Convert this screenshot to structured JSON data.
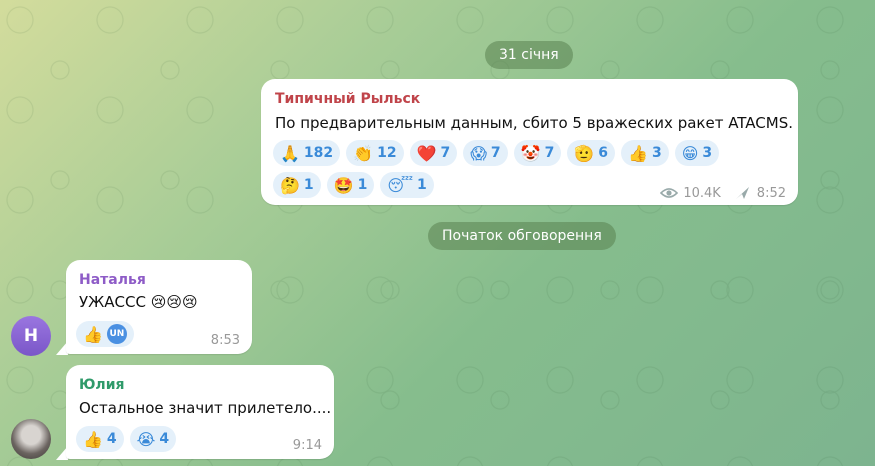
{
  "date_divider": "31 січня",
  "discussion_divider": "Початок обговорення",
  "post": {
    "sender": "Типичный Рыльск",
    "text": "По предварительным данным, сбито 5 вражеских ракет ATACMS.",
    "reactions": [
      {
        "emoji": "🙏",
        "count": "182"
      },
      {
        "emoji": "👏",
        "count": "12"
      },
      {
        "emoji": "❤️",
        "count": "7"
      },
      {
        "emoji": "😱",
        "count": "7"
      },
      {
        "emoji": "🤡",
        "count": "7"
      },
      {
        "emoji": "🫡",
        "count": "6"
      },
      {
        "emoji": "👍",
        "count": "3"
      },
      {
        "emoji": "😁",
        "count": "3"
      },
      {
        "emoji": "🤔",
        "count": "1"
      },
      {
        "emoji": "🤩",
        "count": "1"
      },
      {
        "emoji": "😴",
        "count": "1"
      }
    ],
    "views": "10.4K",
    "time": "8:52",
    "sender_color": "#c0444a"
  },
  "messages": [
    {
      "sender": "Наталья",
      "text": "УЖАССС 😢😢😢",
      "reactions": [
        {
          "emoji": "👍",
          "count": ""
        }
      ],
      "reactor_initials": "UN",
      "time": "8:53",
      "avatar_initial": "Н",
      "sender_color": "#8e5cc7",
      "avatar_color": "#8a63d2"
    },
    {
      "sender": "Юлия",
      "text": "Остальное значит прилетело....",
      "reactions": [
        {
          "emoji": "👍",
          "count": "4"
        },
        {
          "emoji": "😭",
          "count": "4"
        }
      ],
      "time": "9:14",
      "sender_color": "#2f9a6a"
    }
  ],
  "icons": {
    "views": "eye-icon",
    "forward": "share-icon"
  }
}
